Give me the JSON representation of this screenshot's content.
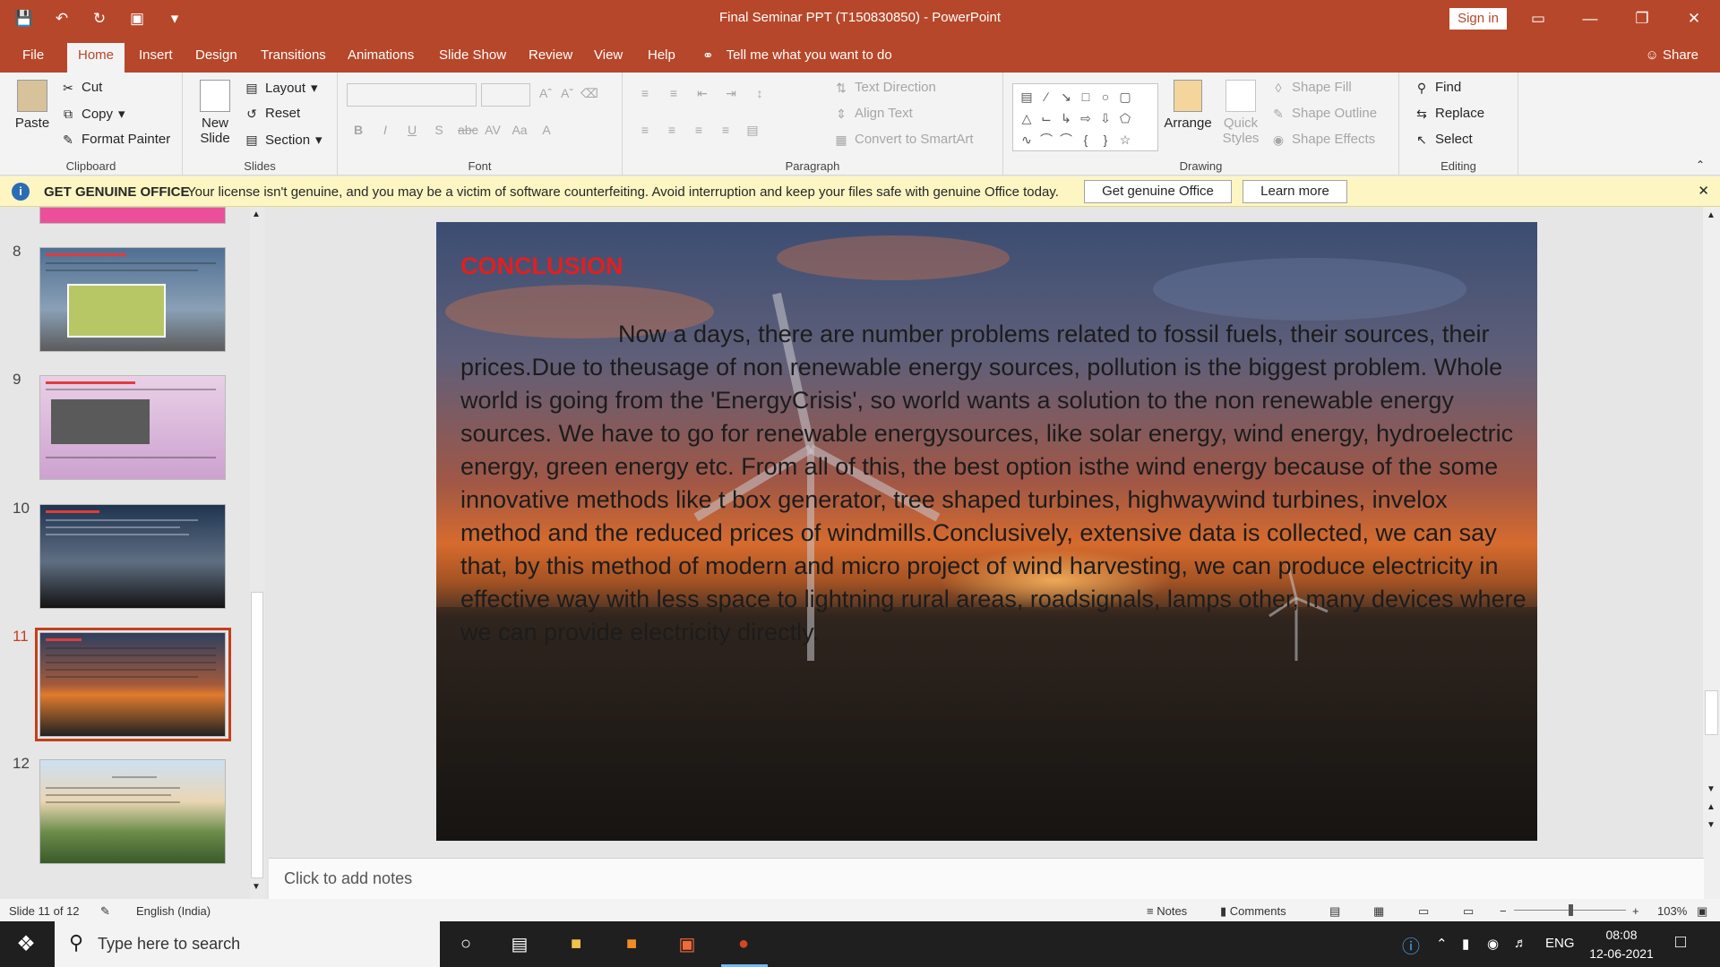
{
  "window": {
    "title": "Final Seminar PPT (T150830850)  -  PowerPoint",
    "signin": "Sign in",
    "quick_access": [
      "save-icon",
      "undo-icon",
      "redo-icon",
      "present-icon",
      "customize-icon"
    ]
  },
  "tabs": [
    "File",
    "Home",
    "Insert",
    "Design",
    "Transitions",
    "Animations",
    "Slide Show",
    "Review",
    "View",
    "Help"
  ],
  "active_tab": "Home",
  "tellme": "Tell me what you want to do",
  "share": "Share",
  "ribbon": {
    "clipboard": {
      "label": "Clipboard",
      "paste": "Paste",
      "cut": "Cut",
      "copy": "Copy",
      "format_painter": "Format Painter"
    },
    "slides": {
      "label": "Slides",
      "new_slide": "New",
      "new_slide2": "Slide",
      "layout": "Layout",
      "reset": "Reset",
      "section": "Section"
    },
    "font": {
      "label": "Font"
    },
    "paragraph": {
      "label": "Paragraph",
      "text_direction": "Text Direction",
      "align_text": "Align Text",
      "smartart": "Convert to SmartArt"
    },
    "drawing": {
      "label": "Drawing",
      "arrange": "Arrange",
      "quick_styles": "Quick",
      "quick_styles2": "Styles",
      "shape_fill": "Shape Fill",
      "shape_outline": "Shape Outline",
      "shape_effects": "Shape Effects"
    },
    "editing": {
      "label": "Editing",
      "find": "Find",
      "replace": "Replace",
      "select": "Select"
    }
  },
  "notice": {
    "heading": "GET GENUINE OFFICE",
    "message": "Your license isn't genuine, and you may be a victim of software counterfeiting. Avoid interruption and keep your files safe with genuine Office today.",
    "btn_genuine": "Get genuine Office",
    "btn_learn": "Learn more"
  },
  "thumbnails": [
    {
      "num": "8"
    },
    {
      "num": "9"
    },
    {
      "num": "10"
    },
    {
      "num": "11"
    },
    {
      "num": "12"
    }
  ],
  "selected_slide": "11",
  "slide": {
    "title": "CONCLUSION",
    "body": "Now a days, there are number problems related to fossil fuels, their sources, their prices.Due to theusage of non renewable energy sources, pollution is the biggest problem. Whole world is going from the 'EnergyCrisis', so world wants a solution to the non renewable energy sources. We have to go for renewable energysources, like solar energy, wind energy, hydroelectric energy, green energy etc. From all of this, the best option isthe wind energy because of the some innovative methods like t box generator, tree shaped turbines, highwaywind turbines, invelox method and the reduced prices of windmills.Conclusively, extensive data is collected, we can say that, by this method of modern and micro project of wind harvesting, we can produce electricity in effective way with less space to lightning rural areas, roadsignals, lamps other, many devices where we can provide electricity directly."
  },
  "notes_placeholder": "Click to add notes",
  "status": {
    "slide_count": "Slide 11 of 12",
    "language": "English (India)",
    "notes": "Notes",
    "comments": "Comments",
    "zoom": "103%"
  },
  "taskbar": {
    "search_placeholder": "Type here to search",
    "lang": "ENG",
    "time": "08:08",
    "date": "12-06-2021"
  },
  "colors": {
    "accent": "#b7472a",
    "selected": "#c43e1c",
    "title_red": "#e02020"
  }
}
